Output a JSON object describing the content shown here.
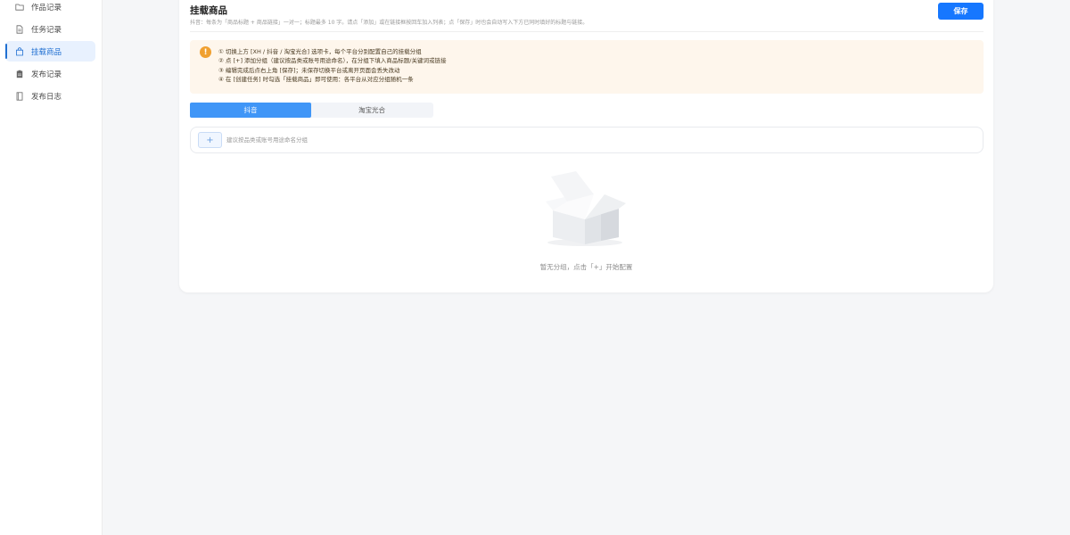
{
  "sidebar": {
    "items": [
      {
        "label": "作品记录",
        "icon": "folder-icon",
        "active": false
      },
      {
        "label": "任务记录",
        "icon": "document-icon",
        "active": false
      },
      {
        "label": "挂载商品",
        "icon": "shopping-bag-icon",
        "active": true
      },
      {
        "label": "发布记录",
        "icon": "clipboard-icon",
        "active": false
      },
      {
        "label": "发布日志",
        "icon": "log-book-icon",
        "active": false
      }
    ]
  },
  "header": {
    "title": "挂载商品",
    "subtitle": "抖音：每条为「商品标题 + 商品链接」一对一；标题最多 10 字。请点「添加」或在链接框按回车加入列表；点「保存」时也会自动写入下方已同时填好的标题与链接。",
    "save_label": "保存"
  },
  "tips": {
    "icon": "!",
    "lines": [
      "① 切换上方 [XH / 抖音 / 淘宝光合] 选项卡，每个平台分别配置自己的挂载分组",
      "② 点 [+] 添加分组（建议按品类或账号用途命名），在分组下填入商品标题/关键词或链接",
      "③ 编辑完成后点右上角 [保存]；未保存切换平台或离开页面会丢失改动",
      "④ 在 [创建任务] 时勾选「挂载商品」即可使用：各平台从对应分组随机一条"
    ]
  },
  "tabs": [
    {
      "label": "抖音",
      "active": true
    },
    {
      "label": "淘宝光合",
      "active": false
    }
  ],
  "group": {
    "add_label": "+",
    "placeholder": "建议按品类或账号用途命名分组"
  },
  "empty": {
    "text": "暂无分组，点击「+」开始配置"
  },
  "colors": {
    "accent": "#1677ff",
    "tab_active": "#4096f7",
    "warning": "#f0a030",
    "tip_bg": "#fef6ec"
  }
}
